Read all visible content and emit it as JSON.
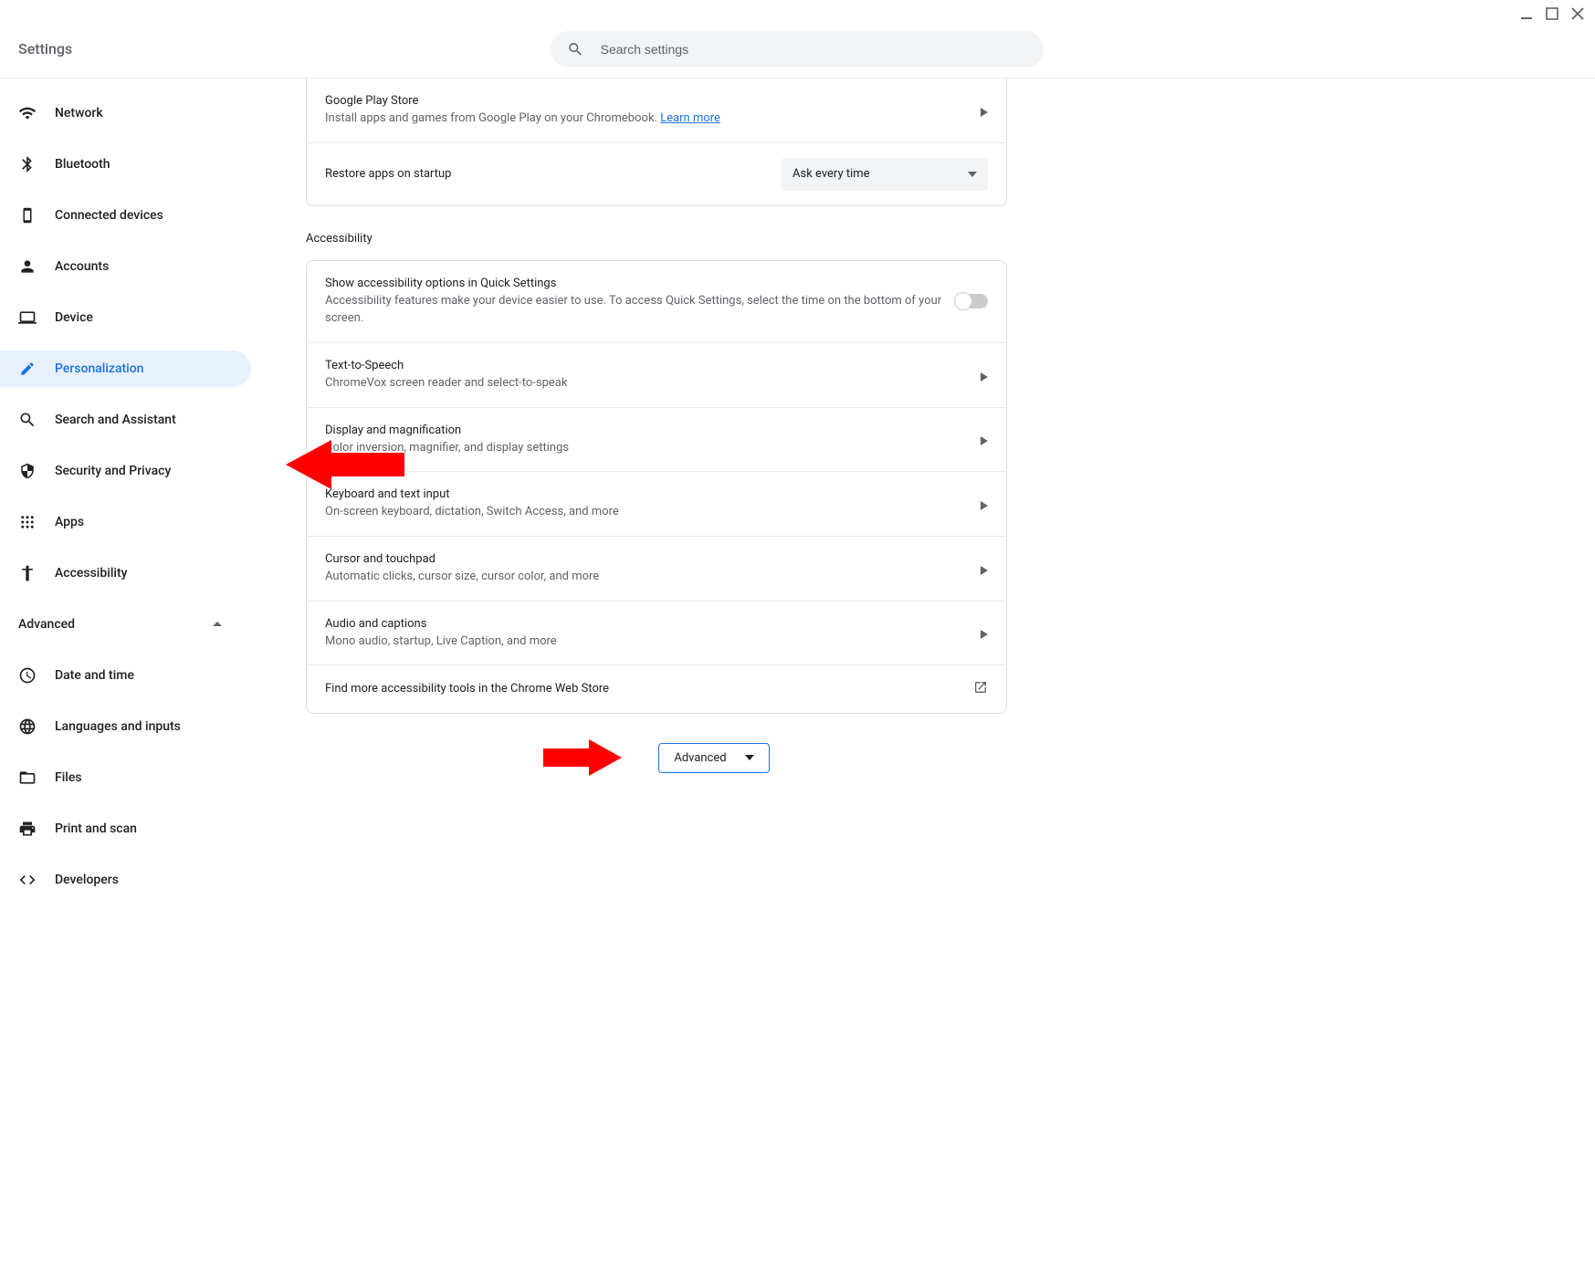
{
  "app": {
    "title": "Settings"
  },
  "search": {
    "placeholder": "Search settings"
  },
  "sidebar": {
    "items": [
      {
        "label": "Network"
      },
      {
        "label": "Bluetooth"
      },
      {
        "label": "Connected devices"
      },
      {
        "label": "Accounts"
      },
      {
        "label": "Device"
      },
      {
        "label": "Personalization"
      },
      {
        "label": "Search and Assistant"
      },
      {
        "label": "Security and Privacy"
      },
      {
        "label": "Apps"
      },
      {
        "label": "Accessibility"
      }
    ],
    "advanced_label": "Advanced",
    "advanced_items": [
      {
        "label": "Date and time"
      },
      {
        "label": "Languages and inputs"
      },
      {
        "label": "Files"
      },
      {
        "label": "Print and scan"
      },
      {
        "label": "Developers"
      }
    ]
  },
  "main": {
    "google_play": {
      "title": "Google Play Store",
      "sub_pre": "Install apps and games from Google Play on your Chromebook. ",
      "learn_more": "Learn more"
    },
    "restore_apps": {
      "title": "Restore apps on startup",
      "selected": "Ask every time"
    },
    "accessibility_section_title": "Accessibility",
    "accessibility": {
      "quick": {
        "title": "Show accessibility options in Quick Settings",
        "sub": "Accessibility features make your device easier to use. To access Quick Settings, select the time on the bottom of your screen."
      },
      "rows": [
        {
          "title": "Text-to-Speech",
          "sub": "ChromeVox screen reader and select-to-speak"
        },
        {
          "title": "Display and magnification",
          "sub": "Color inversion, magnifier, and display settings"
        },
        {
          "title": "Keyboard and text input",
          "sub": "On-screen keyboard, dictation, Switch Access, and more"
        },
        {
          "title": "Cursor and touchpad",
          "sub": "Automatic clicks, cursor size, cursor color, and more"
        },
        {
          "title": "Audio and captions",
          "sub": "Mono audio, startup, Live Caption, and more"
        }
      ],
      "web_store": "Find more accessibility tools in the Chrome Web Store"
    },
    "advanced_button": "Advanced"
  }
}
